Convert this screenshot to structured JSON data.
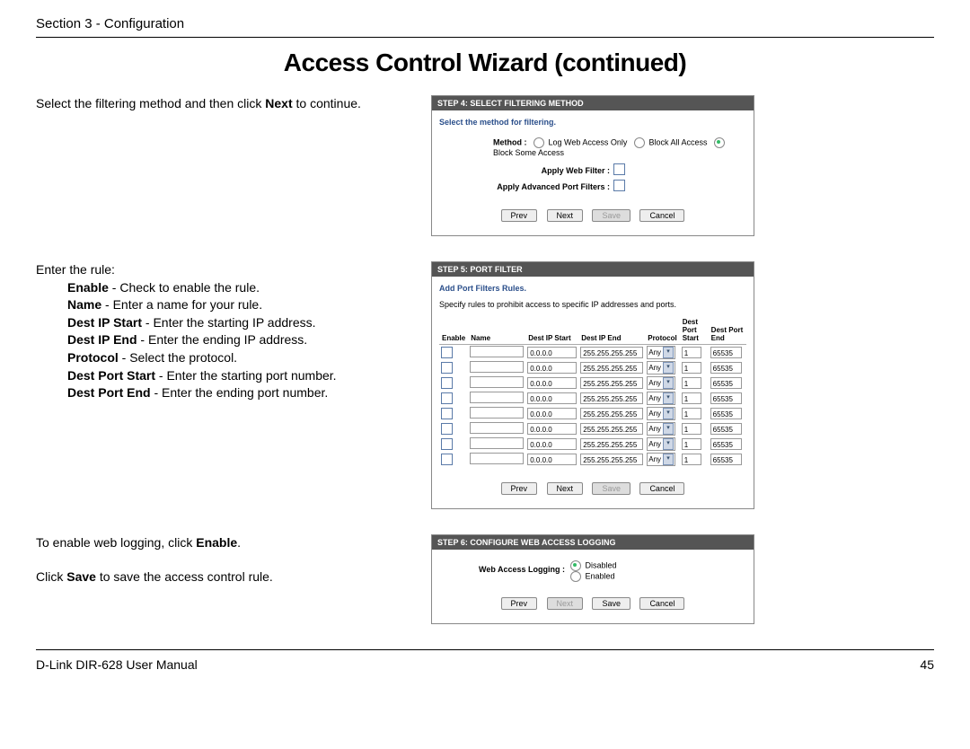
{
  "header": {
    "section": "Section 3 - Configuration"
  },
  "title": "Access Control Wizard (continued)",
  "sec1": {
    "intro_before": "Select the filtering method and then click ",
    "intro_bold": "Next",
    "intro_after": " to continue.",
    "step_header": "STEP 4: SELECT FILTERING METHOD",
    "prompt": "Select the method for filtering.",
    "method_label": "Method :",
    "method_options": {
      "log": "Log Web Access Only",
      "block_all": "Block All Access",
      "block_some": "Block Some Access"
    },
    "apply_web": "Apply Web Filter :",
    "apply_adv": "Apply Advanced Port Filters :",
    "buttons": {
      "prev": "Prev",
      "next": "Next",
      "save": "Save",
      "cancel": "Cancel"
    }
  },
  "sec2": {
    "intro": "Enter the rule:",
    "defs": {
      "enable_b": "Enable",
      "enable_t": " - Check to enable the rule.",
      "name_b": "Name",
      "name_t": " - Enter a name for your rule.",
      "dipstart_b": "Dest IP Start",
      "dipstart_t": " - Enter the starting IP address.",
      "dipend_b": "Dest IP End",
      "dipend_t": " - Enter the ending IP address.",
      "proto_b": "Protocol",
      "proto_t": " - Select the protocol.",
      "dpstart_b": "Dest Port Start",
      "dpstart_t": " - Enter the starting port number.",
      "dpend_b": "Dest Port End",
      "dpend_t": " - Enter the ending port number."
    },
    "step_header": "STEP 5: PORT FILTER",
    "prompt": "Add Port Filters Rules.",
    "subtext": "Specify rules to prohibit access to specific IP addresses and ports.",
    "columns": {
      "enable": "Enable",
      "name": "Name",
      "dipstart": "Dest IP Start",
      "dipend": "Dest IP End",
      "protocol": "Protocol",
      "dpstart": "Dest Port Start",
      "dpend": "Dest Port End"
    },
    "row": {
      "dipstart": "0.0.0.0",
      "dipend": "255.255.255.255",
      "protocol": "Any",
      "dpstart": "1",
      "dpend": "65535"
    },
    "row_count": 8,
    "buttons": {
      "prev": "Prev",
      "next": "Next",
      "save": "Save",
      "cancel": "Cancel"
    }
  },
  "sec3": {
    "intro_before": "To enable web logging, click ",
    "intro_bold": "Enable",
    "intro_after": ".",
    "save_before": "Click ",
    "save_bold": "Save",
    "save_after": " to save the access control rule.",
    "step_header": "STEP 6: CONFIGURE WEB ACCESS LOGGING",
    "label": "Web Access Logging :",
    "opt_disabled": "Disabled",
    "opt_enabled": "Enabled",
    "buttons": {
      "prev": "Prev",
      "next": "Next",
      "save": "Save",
      "cancel": "Cancel"
    }
  },
  "footer": {
    "manual": "D-Link DIR-628 User Manual",
    "page": "45"
  }
}
